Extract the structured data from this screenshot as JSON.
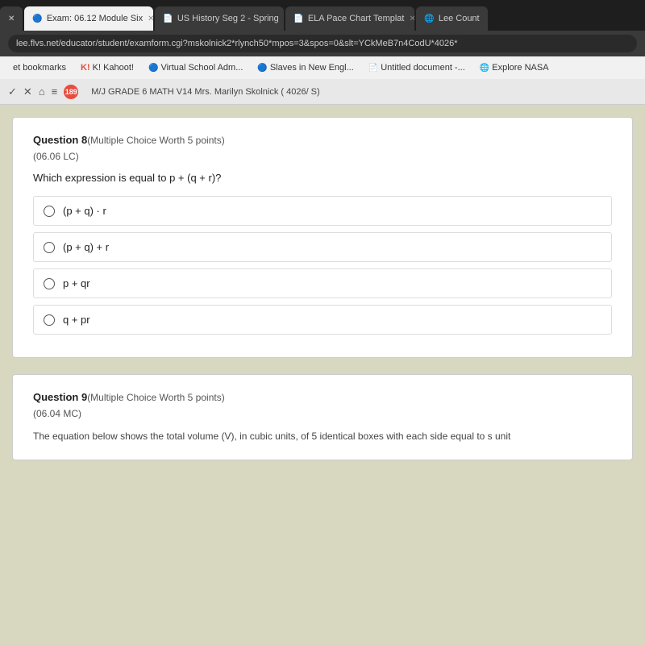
{
  "browser": {
    "tabs": [
      {
        "id": "tab1",
        "label": "x",
        "icon": "✕",
        "type": "close",
        "active": false
      },
      {
        "id": "tab2",
        "label": "Exam: 06.12 Module Six",
        "icon": "🔵",
        "active": true
      },
      {
        "id": "tab3",
        "label": "US History Seg 2 - Spring",
        "icon": "📄",
        "active": false
      },
      {
        "id": "tab4",
        "label": "ELA Pace Chart Templat",
        "icon": "📄",
        "active": false
      },
      {
        "id": "tab5",
        "label": "Lee Count",
        "icon": "🌐",
        "active": false
      }
    ],
    "address_url": "lee.flvs.net/educator/student/examform.cgi?mskolnick2*rlynch50*mpos=3&spos=0&slt=YCkMeB7n4CodU*4026*",
    "bookmarks": [
      {
        "label": "et bookmarks"
      },
      {
        "label": "K! Kahoot!",
        "icon": "K"
      },
      {
        "label": "Virtual School Adm...",
        "icon": "🔵"
      },
      {
        "label": "Slaves in New Engl...",
        "icon": "🔵"
      },
      {
        "label": "Untitled document -...",
        "icon": "📄"
      },
      {
        "label": "Explore NASA",
        "icon": "🌐"
      }
    ],
    "course_bar": {
      "badge_count": "189",
      "course_name": "M/J GRADE 6 MATH V14  Mrs. Marilyn Skolnick ( 4026/ S)"
    }
  },
  "question8": {
    "number": "Question 8",
    "type": "(Multiple Choice Worth 5 points)",
    "code": "(06.06 LC)",
    "text": "Which expression is equal to p + (q + r)?",
    "options": [
      {
        "id": "a",
        "text": "(p + q) · r"
      },
      {
        "id": "b",
        "text": "(p + q) + r"
      },
      {
        "id": "c",
        "text": "p + qr"
      },
      {
        "id": "d",
        "text": "q + pr"
      }
    ]
  },
  "question9": {
    "number": "Question 9",
    "type": "(Multiple Choice Worth 5 points)",
    "code": "(06.04 MC)",
    "text": "The equation below shows the total volume (V), in cubic units, of 5 identical boxes with each side equal to s unit"
  }
}
